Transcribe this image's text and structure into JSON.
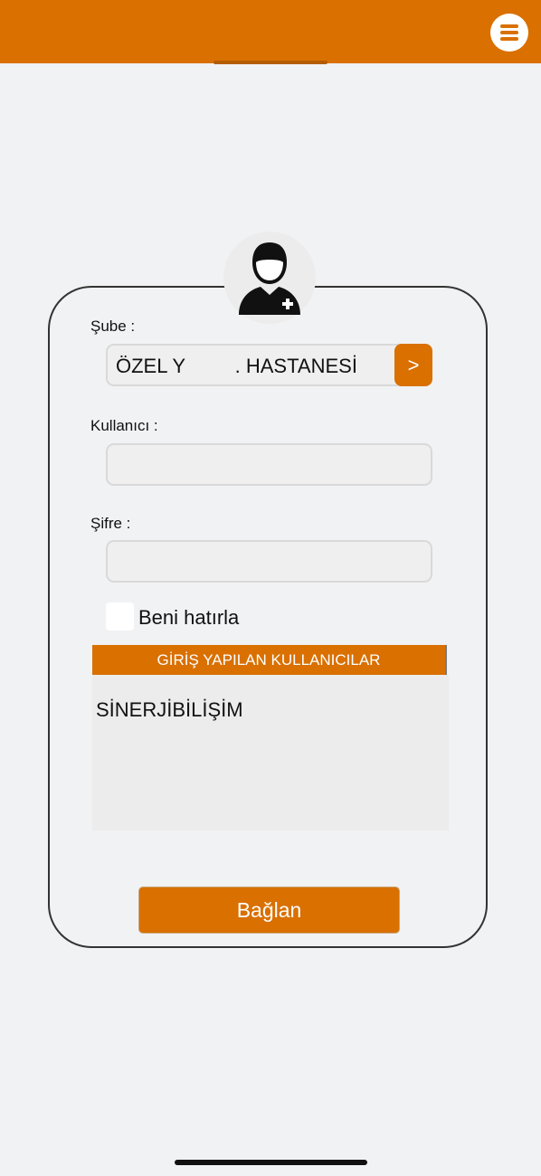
{
  "header": {
    "background_color": "#d97000",
    "menu_icon": "hamburger-menu-icon"
  },
  "avatar": {
    "icon": "user-doctor-plus-icon"
  },
  "form": {
    "branch_label": "Şube :",
    "branch_value": "ÖZEL Y         . HASTANESİ",
    "branch_button_label": ">",
    "user_label": "Kullanıcı :",
    "user_value": "",
    "password_label": "Şifre :",
    "password_value": "",
    "remember_label": "Beni hatırla",
    "remember_checked": false
  },
  "logged_users": {
    "header": "GİRİŞ YAPILAN KULLANICILAR",
    "items": [
      "SİNERJİBİLİŞİM"
    ]
  },
  "actions": {
    "connect_label": "Bağlan"
  },
  "colors": {
    "accent": "#d97000",
    "background": "#f1f2f4"
  }
}
